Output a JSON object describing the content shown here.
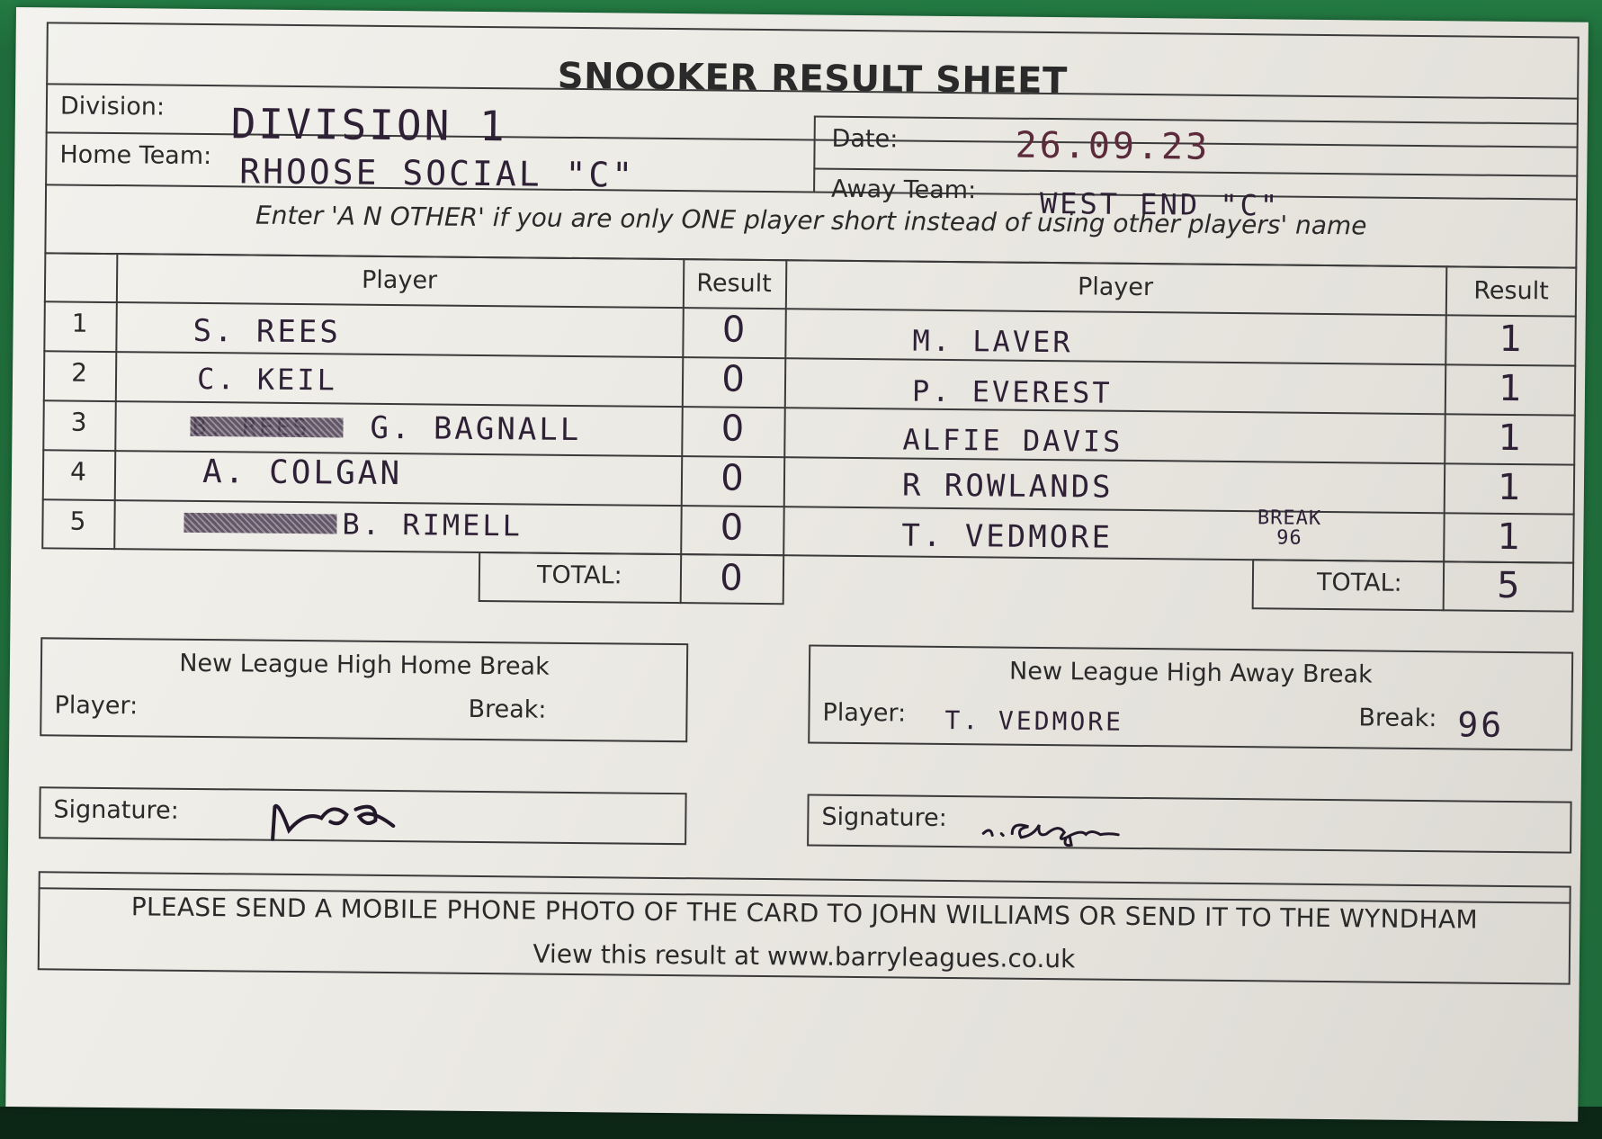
{
  "header": {
    "title": "SNOOKER RESULT SHEET",
    "division_label": "Division:",
    "division_value": "DIVISION 1",
    "date_label": "Date:",
    "date_value": "26.09.23",
    "home_team_label": "Home Team:",
    "home_team_value": "RHOOSE SOCIAL \"C\"",
    "away_team_label": "Away Team:",
    "away_team_value": "WEST END \"C\"",
    "instruction": "Enter 'A N OTHER' if you are only ONE player short instead of using other players' name"
  },
  "columns": {
    "player": "Player",
    "result": "Result"
  },
  "frames": [
    {
      "num": "1",
      "home_player": "S. REES",
      "home_result": "0",
      "away_player": "M. LAVER",
      "away_result": "1"
    },
    {
      "num": "2",
      "home_player": "C. KEIL",
      "home_result": "0",
      "away_player": "P. EVEREST",
      "away_result": "1"
    },
    {
      "num": "3",
      "home_crossed": "B. REES",
      "home_player": "G. BAGNALL",
      "home_result": "0",
      "away_player": "ALFIE DAVIS",
      "away_result": "1"
    },
    {
      "num": "4",
      "home_player": "A. COLGAN",
      "home_result": "0",
      "away_player": "R ROWLANDS",
      "away_result": "1"
    },
    {
      "num": "5",
      "home_player": "B. RIMELL",
      "home_result": "0",
      "away_player": "T. VEDMORE",
      "away_note": "BREAK 96",
      "away_result": "1"
    }
  ],
  "totals": {
    "label": "TOTAL:",
    "home": "0",
    "away": "5"
  },
  "high_breaks": {
    "home_title": "New League High Home Break",
    "away_title": "New League High Away Break",
    "player_label": "Player:",
    "break_label": "Break:",
    "home_player": "",
    "home_break": "",
    "away_player": "T. VEDMORE",
    "away_break": "96"
  },
  "signature_label": "Signature:",
  "footer": {
    "instruction": "PLEASE SEND A MOBILE PHONE PHOTO OF THE CARD TO JOHN WILLIAMS OR SEND IT TO THE WYNDHAM",
    "link_text": "View this result at www.barryleagues.co.uk"
  }
}
